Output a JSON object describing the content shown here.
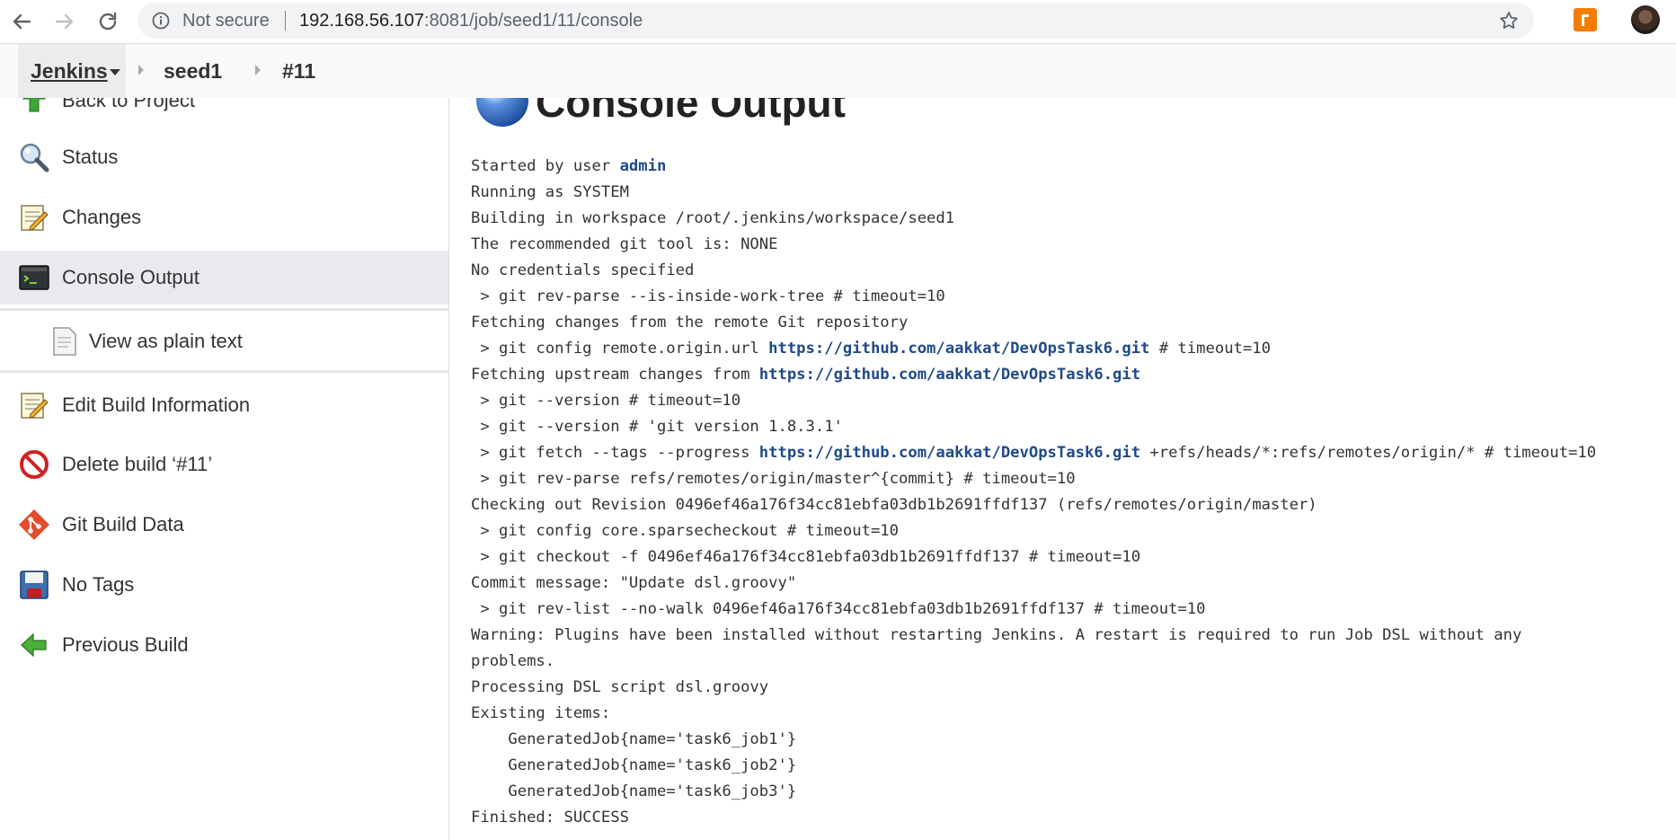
{
  "browser": {
    "security_label": "Not secure",
    "url_host": "192.168.56.107",
    "url_rest": ":8081/job/seed1/11/console",
    "icons": [
      "back-arrow-icon",
      "forward-arrow-icon",
      "reload-icon",
      "info-icon",
      "star-icon",
      "extension-icon",
      "profile-avatar"
    ]
  },
  "breadcrumbs": {
    "home": "Jenkins",
    "job": "seed1",
    "build": "#11"
  },
  "sidebar": {
    "items": [
      {
        "label": "Back to Project",
        "icon": "up-arrow-icon"
      },
      {
        "label": "Status",
        "icon": "magnifier-icon"
      },
      {
        "label": "Changes",
        "icon": "notepad-icon"
      },
      {
        "label": "Console Output",
        "icon": "terminal-icon"
      },
      {
        "label": "View as plain text",
        "icon": "document-icon"
      },
      {
        "label": "Edit Build Information",
        "icon": "notepad-icon"
      },
      {
        "label": "Delete build ‘#11’",
        "icon": "no-entry-icon"
      },
      {
        "label": "Git Build Data",
        "icon": "git-icon"
      },
      {
        "label": "No Tags",
        "icon": "save-icon"
      },
      {
        "label": "Previous Build",
        "icon": "left-arrow-icon"
      }
    ]
  },
  "main": {
    "title": "Console Output",
    "console": {
      "started_prefix": "Started by user ",
      "started_user": "admin",
      "repo_url": "https://github.com/aakkat/DevOpsTask6.git",
      "l_running": "Running as SYSTEM",
      "l_workspace": "Building in workspace /root/.jenkins/workspace/seed1",
      "l_tool": "The recommended git tool is: NONE",
      "l_creds": "No credentials specified",
      "l_revparse": " > git rev-parse --is-inside-work-tree # timeout=10",
      "l_fetching": "Fetching changes from the remote Git repository",
      "l_config_prefix": " > git config remote.origin.url ",
      "l_config_suffix": " # timeout=10",
      "l_upstream_prefix": "Fetching upstream changes from ",
      "l_version1": " > git --version # timeout=10",
      "l_version2": " > git --version # 'git version 1.8.3.1'",
      "l_fetch_prefix": " > git fetch --tags --progress ",
      "l_fetch_suffix": " +refs/heads/*:refs/remotes/origin/* # timeout=10",
      "l_revparse2": " > git rev-parse refs/remotes/origin/master^{commit} # timeout=10",
      "l_checking": "Checking out Revision 0496ef46a176f34cc81ebfa03db1b2691ffdf137 (refs/remotes/origin/master)",
      "l_sparse": " > git config core.sparsecheckout # timeout=10",
      "l_checkout": " > git checkout -f 0496ef46a176f34cc81ebfa03db1b2691ffdf137 # timeout=10",
      "l_commitmsg": "Commit message: \"Update dsl.groovy\"",
      "l_revlist": " > git rev-list --no-walk 0496ef46a176f34cc81ebfa03db1b2691ffdf137 # timeout=10",
      "l_warning": "Warning: Plugins have been installed without restarting Jenkins. A restart is required to run Job DSL without any",
      "l_problems": "problems.",
      "l_processing": "Processing DSL script dsl.groovy",
      "l_existing": "Existing items:",
      "l_job1": "    GeneratedJob{name='task6_job1'}",
      "l_job2": "    GeneratedJob{name='task6_job2'}",
      "l_job3": "    GeneratedJob{name='task6_job3'}",
      "l_finished": "Finished: SUCCESS"
    }
  }
}
